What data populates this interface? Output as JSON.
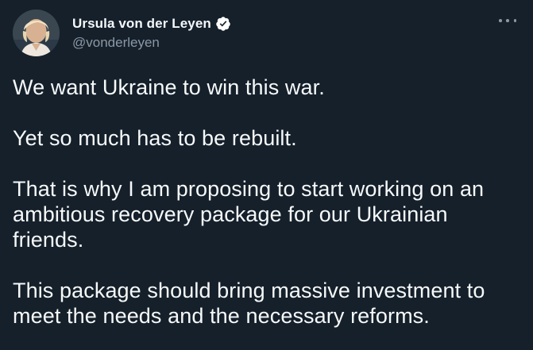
{
  "author": {
    "display_name": "Ursula von der Leyen",
    "handle": "@vonderleyen",
    "verified_icon": "verified-badge-icon"
  },
  "actions": {
    "more_icon": "more-horizontal-icon"
  },
  "tweet": {
    "paragraphs": [
      "We want Ukraine to win this war.",
      "Yet so much has to be rebuilt.",
      "That is why I am proposing to start working on an ambitious recovery package for our Ukrainian friends.",
      "This package should bring massive investment to meet the needs and the necessary reforms."
    ]
  },
  "colors": {
    "background": "#15202b",
    "text": "#f7f9f9",
    "secondary_text": "#8b98a5",
    "verified": "#ffffff"
  }
}
